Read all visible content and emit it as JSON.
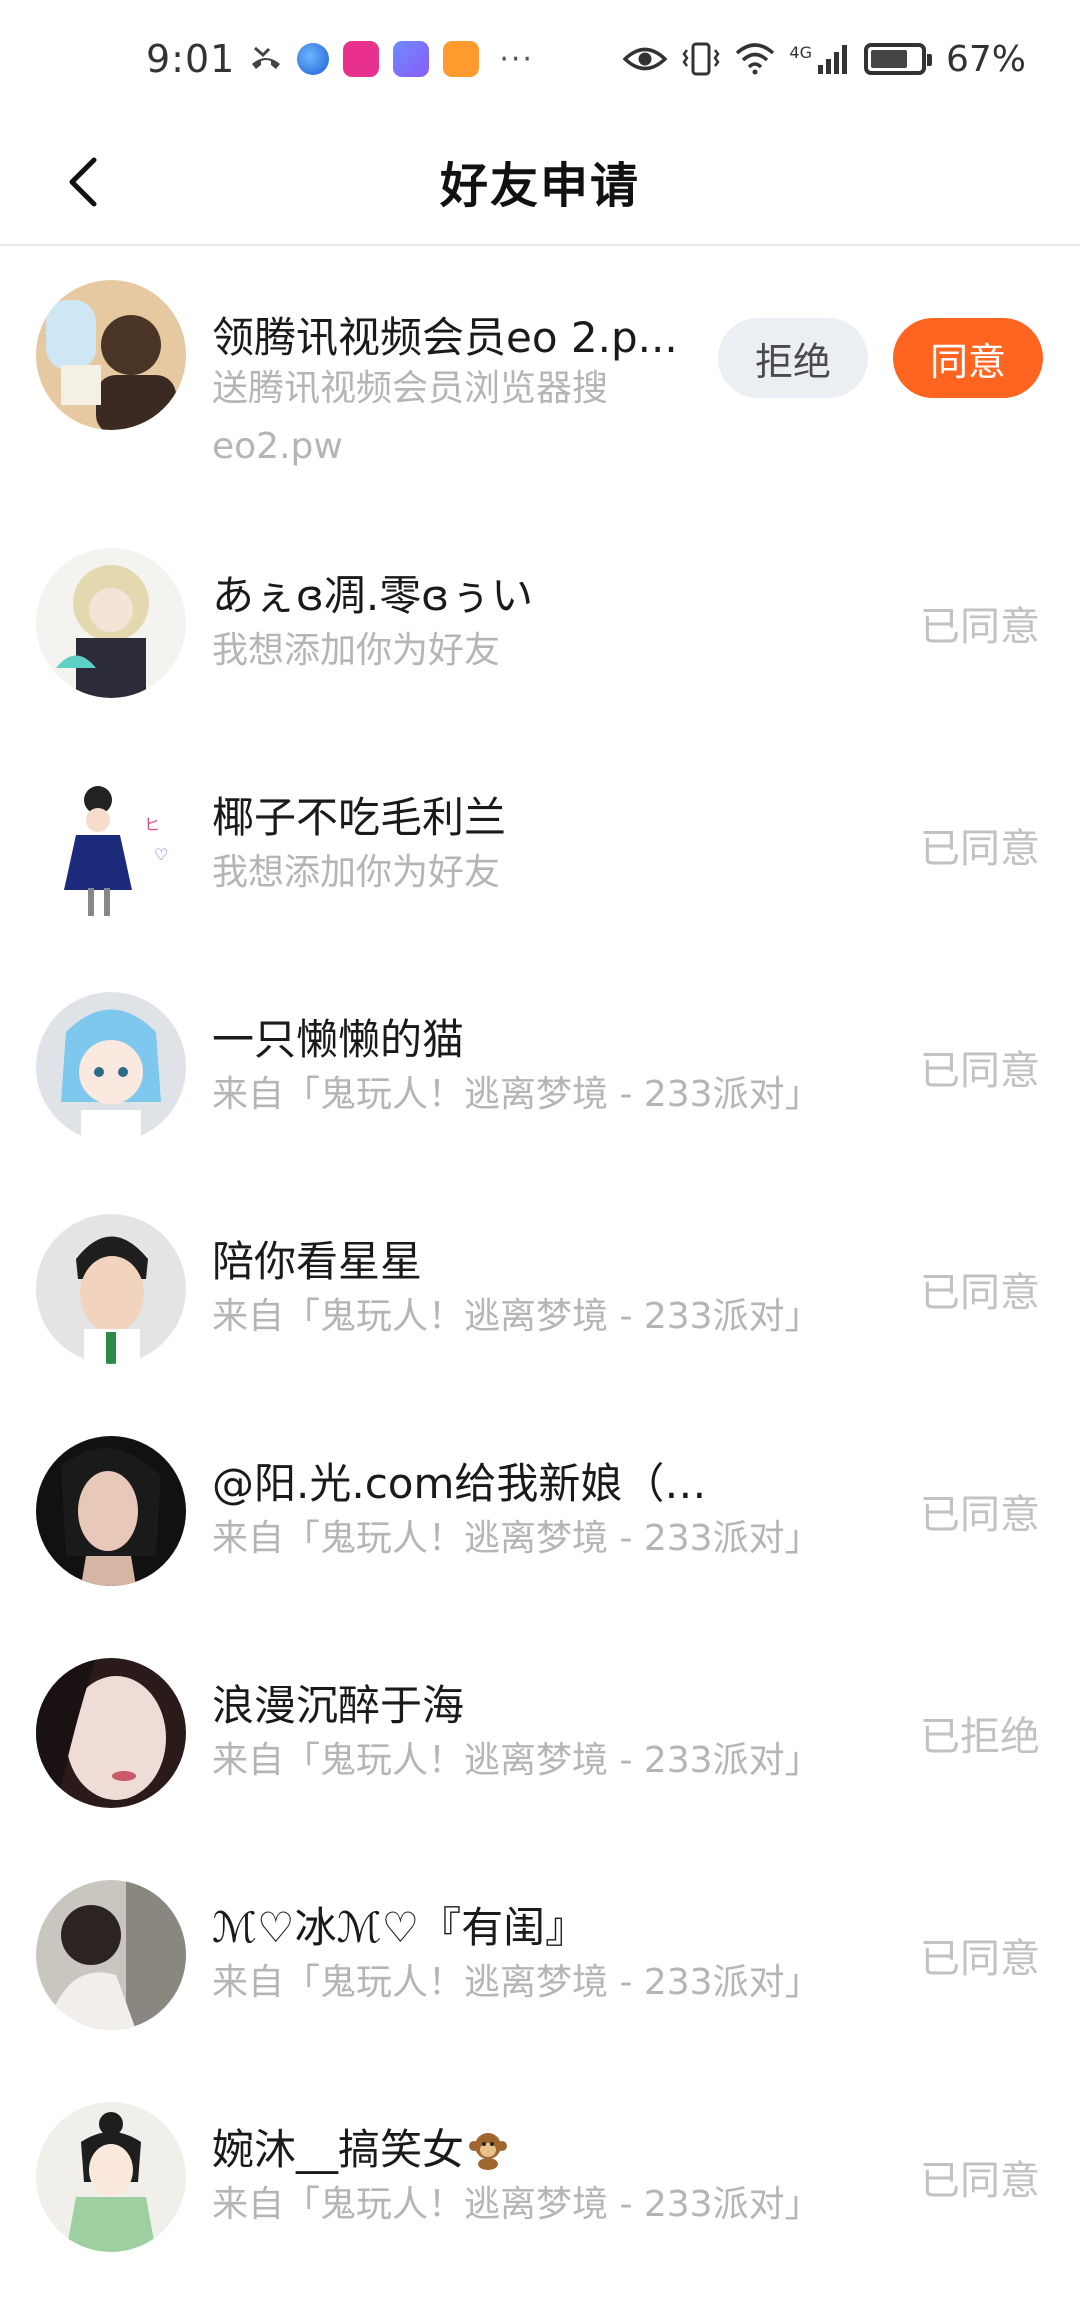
{
  "status_bar": {
    "time": "9:01",
    "more": "···",
    "battery_percent": "67%",
    "network": "4G"
  },
  "header": {
    "title": "好友申请"
  },
  "requests": [
    {
      "name": "领腾讯视频会员eo 2.p...",
      "message": "送腾讯视频会员浏览器搜eo2.pw",
      "reject_label": "拒绝",
      "accept_label": "同意"
    },
    {
      "name": "あぇɞ凋.零ɞぅい",
      "message": "我想添加你为好友",
      "status": "已同意"
    },
    {
      "name": "椰子不吃毛利兰",
      "message": "我想添加你为好友",
      "status": "已同意"
    },
    {
      "name": "一只懒懒的猫",
      "message": "来自「鬼玩人！逃离梦境 - 233派对」",
      "status": "已同意"
    },
    {
      "name": "陪你看星星",
      "message": "来自「鬼玩人！逃离梦境 - 233派对」",
      "status": "已同意"
    },
    {
      "name": "@阳.光.com给我新娘（没对象",
      "message": "来自「鬼玩人！逃离梦境 - 233派对」",
      "status": "已同意"
    },
    {
      "name": "浪漫沉醉于海",
      "message": "来自「鬼玩人！逃离梦境 - 233派对」",
      "status": "已拒绝"
    },
    {
      "name": "ℳ♡冰ℳ♡『有闺』",
      "message": "来自「鬼玩人！逃离梦境 - 233派对」",
      "status": "已同意"
    },
    {
      "name": "婉沐__搞笑女",
      "message": "来自「鬼玩人！逃离梦境 - 233派对」",
      "status": "已同意"
    }
  ]
}
